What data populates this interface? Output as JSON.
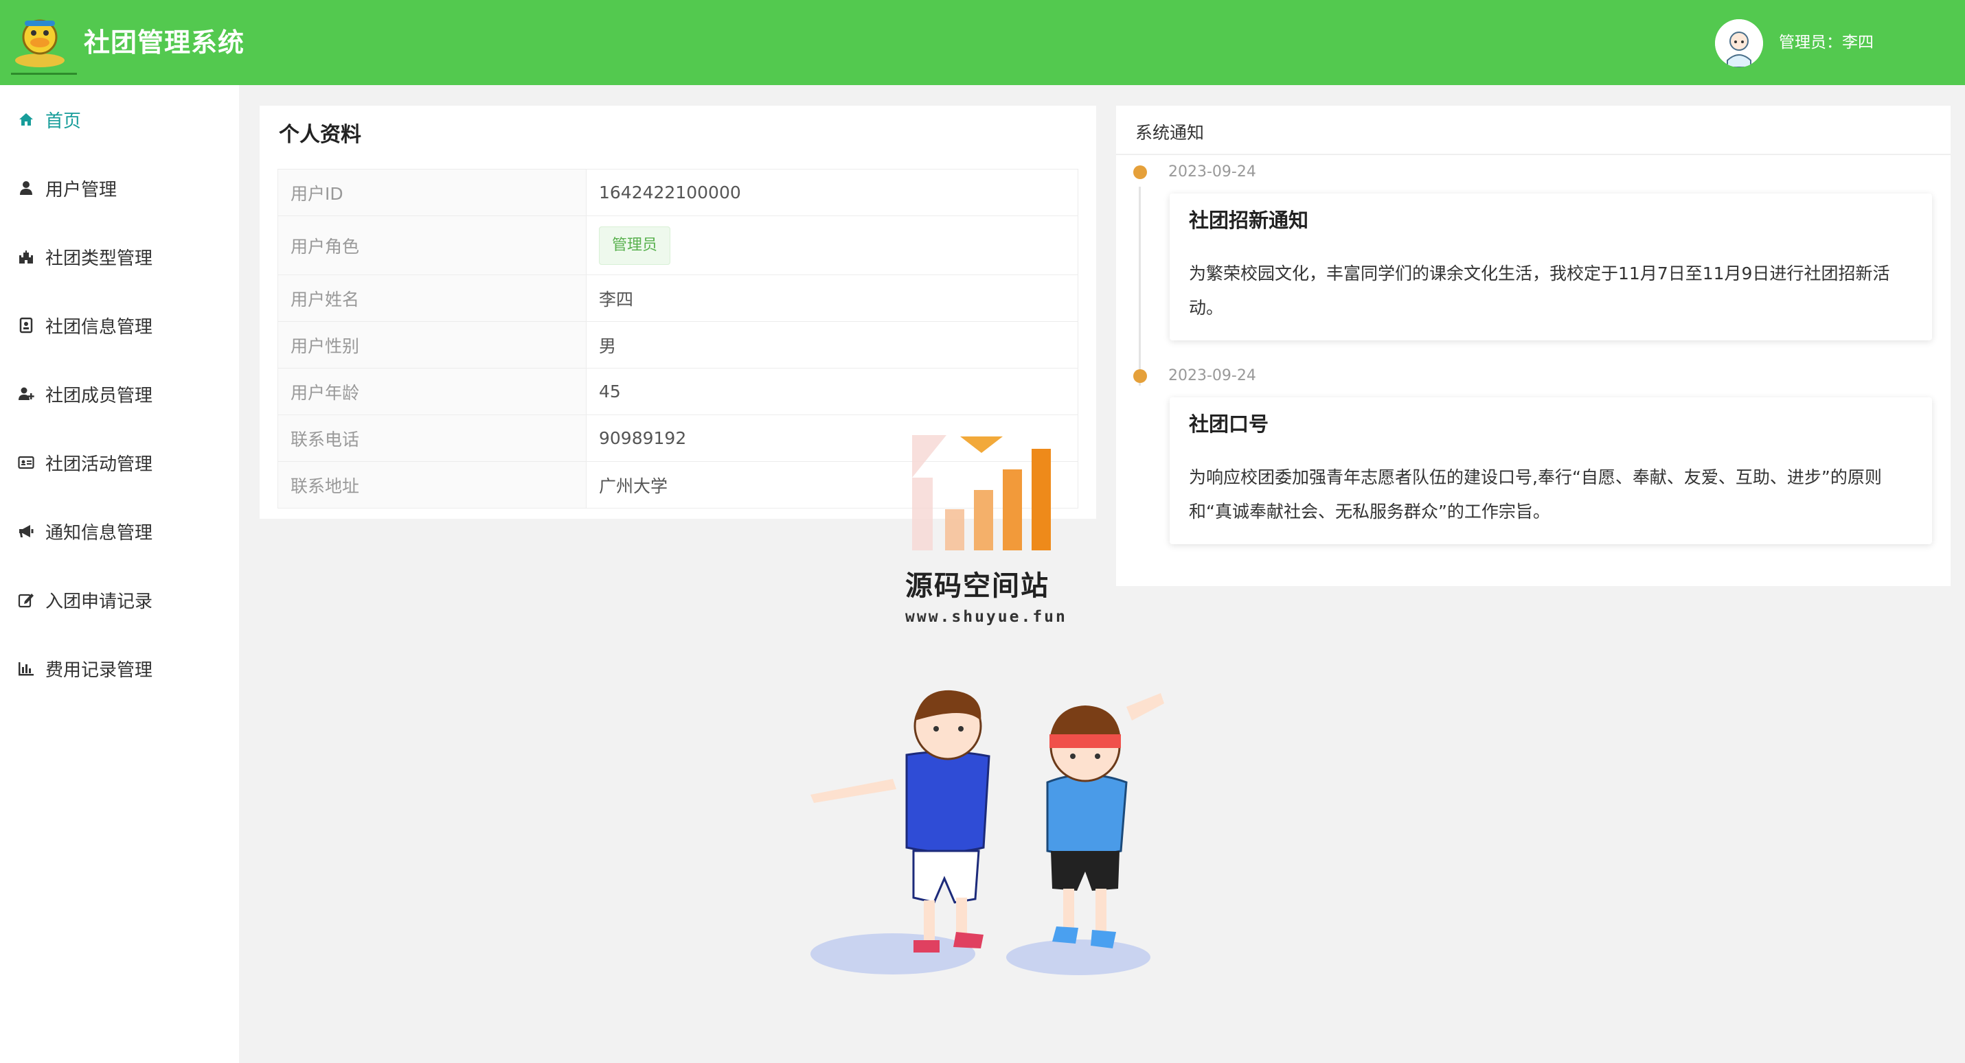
{
  "header": {
    "app_title": "社团管理系统",
    "user_label": "管理员：李四",
    "logo_icon": "duck-mascot-logo-icon",
    "avatar_icon": "user-avatar-icon",
    "background_color": "#53c94f"
  },
  "sidebar": {
    "items": [
      {
        "label": "首页",
        "icon": "home-icon",
        "active": true
      },
      {
        "label": "用户管理",
        "icon": "user-icon"
      },
      {
        "label": "社团类型管理",
        "icon": "castle-icon"
      },
      {
        "label": "社团信息管理",
        "icon": "id-badge-icon"
      },
      {
        "label": "社团成员管理",
        "icon": "user-plus-icon"
      },
      {
        "label": "社团活动管理",
        "icon": "id-card-icon"
      },
      {
        "label": "通知信息管理",
        "icon": "bullhorn-icon"
      },
      {
        "label": "入团申请记录",
        "icon": "edit-icon"
      },
      {
        "label": "费用记录管理",
        "icon": "bar-chart-icon"
      }
    ],
    "active_color": "#179d9a"
  },
  "profile": {
    "title": "个人资料",
    "rows": [
      {
        "key": "用户ID",
        "value": "1642422100000"
      },
      {
        "key": "用户角色",
        "value": "管理员"
      },
      {
        "key": "用户姓名",
        "value": "李四"
      },
      {
        "key": "用户性别",
        "value": "男"
      },
      {
        "key": "用户年龄",
        "value": "45"
      },
      {
        "key": "联系电话",
        "value": "90989192"
      },
      {
        "key": "联系地址",
        "value": "广州大学"
      }
    ]
  },
  "notices": {
    "title": "系统通知",
    "items": [
      {
        "date": "2023-09-24",
        "title": "社团招新通知",
        "body": "为繁荣校园文化，丰富同学们的课余文化生活，我校定于11月7日至11月9日进行社团招新活动。"
      },
      {
        "date": "2023-09-24",
        "title": "社团口号",
        "body": "为响应校团委加强青年志愿者队伍的建设口号,奉行“自愿、奉献、友爱、互助、进步”的原则和“真诚奉献社会、无私服务群众”的工作宗旨。"
      }
    ],
    "dot_color": "#e5a03a"
  },
  "watermark": {
    "title": "源码空间站",
    "url": "www.shuyue.fun"
  }
}
